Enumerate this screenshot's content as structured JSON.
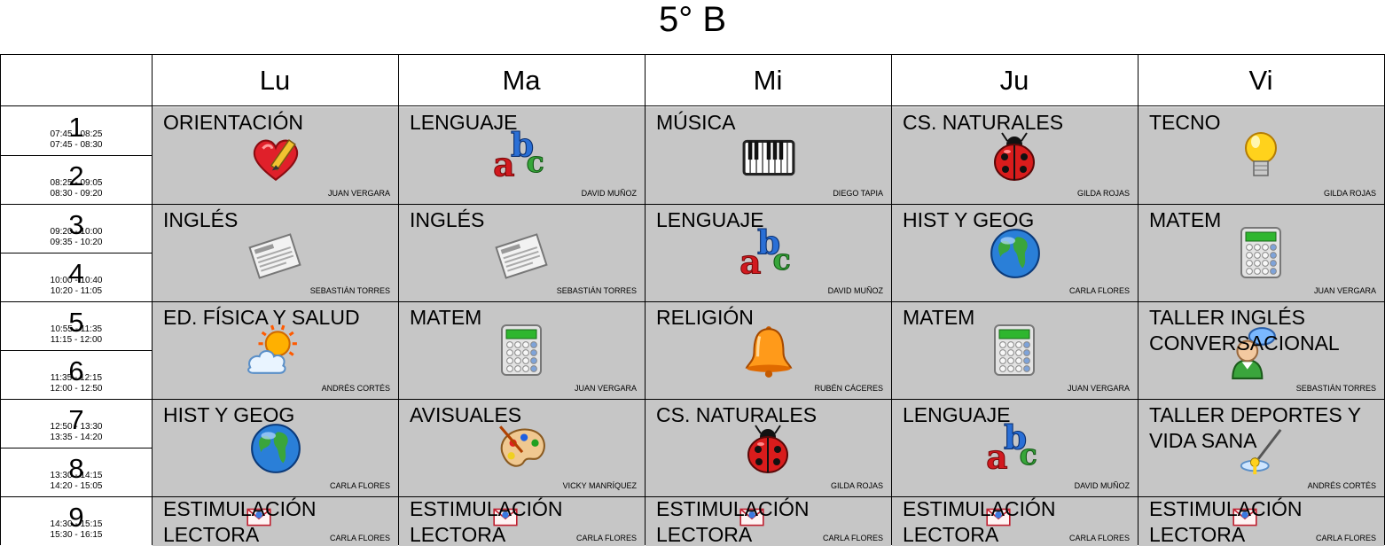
{
  "title": "5° B",
  "days": [
    "Lu",
    "Ma",
    "Mi",
    "Ju",
    "Vi"
  ],
  "slots": [
    {
      "num": "1",
      "time_a": "07:45 - 08:25",
      "time_b": "07:45 - 08:30"
    },
    {
      "num": "2",
      "time_a": "08:25 - 09:05",
      "time_b": "08:30 - 09:20"
    },
    {
      "num": "3",
      "time_a": "09:20 - 10:00",
      "time_b": "09:35 - 10:20"
    },
    {
      "num": "4",
      "time_a": "10:00 - 10:40",
      "time_b": "10:20 - 11:05"
    },
    {
      "num": "5",
      "time_a": "10:55 - 11:35",
      "time_b": "11:15 - 12:00"
    },
    {
      "num": "6",
      "time_a": "11:35 - 12:15",
      "time_b": "12:00 - 12:50"
    },
    {
      "num": "7",
      "time_a": "12:50 - 13:30",
      "time_b": "13:35 - 14:20"
    },
    {
      "num": "8",
      "time_a": "13:30 - 14:15",
      "time_b": "14:20 - 15:05"
    },
    {
      "num": "9",
      "time_a": "14:30 - 15:15",
      "time_b": "15:30 - 16:15"
    }
  ],
  "rows": [
    [
      {
        "subject": "ORIENTACIÓN",
        "teacher": "JUAN VERGARA",
        "icon": "heart-pencil-icon"
      },
      {
        "subject": "LENGUAJE",
        "teacher": "DAVID MUÑOZ",
        "icon": "abc-icon"
      },
      {
        "subject": "MÚSICA",
        "teacher": "DIEGO TAPIA",
        "icon": "piano-icon"
      },
      {
        "subject": "CS. NATURALES",
        "teacher": "GILDA ROJAS",
        "icon": "ladybug-icon"
      },
      {
        "subject": "TECNO",
        "teacher": "GILDA ROJAS",
        "icon": "lightbulb-icon"
      }
    ],
    [
      {
        "subject": "INGLÉS",
        "teacher": "SEBASTIÁN TORRES",
        "icon": "newspaper-icon"
      },
      {
        "subject": "INGLÉS",
        "teacher": "SEBASTIÁN TORRES",
        "icon": "newspaper-icon"
      },
      {
        "subject": "LENGUAJE",
        "teacher": "DAVID MUÑOZ",
        "icon": "abc-icon"
      },
      {
        "subject": "HIST Y GEOG",
        "teacher": "CARLA FLORES",
        "icon": "globe-icon"
      },
      {
        "subject": "MATEM",
        "teacher": "JUAN VERGARA",
        "icon": "calculator-icon"
      }
    ],
    [
      {
        "subject": "ED. FÍSICA Y SALUD",
        "teacher": "ANDRÉS CORTÉS",
        "icon": "sun-cloud-icon"
      },
      {
        "subject": "MATEM",
        "teacher": "JUAN VERGARA",
        "icon": "calculator-icon"
      },
      {
        "subject": "RELIGIÓN",
        "teacher": "RUBÉN CÁCERES",
        "icon": "bell-icon"
      },
      {
        "subject": "MATEM",
        "teacher": "JUAN VERGARA",
        "icon": "calculator-icon"
      },
      {
        "subject": "TALLER INGLÉS\nCONVERSACIONAL",
        "teacher": "SEBASTIÁN TORRES",
        "icon": "chat-person-icon"
      }
    ],
    [
      {
        "subject": "HIST Y GEOG",
        "teacher": "CARLA FLORES",
        "icon": "globe-icon"
      },
      {
        "subject": "AVISUALES",
        "teacher": "VICKY MANRÍQUEZ",
        "icon": "palette-icon"
      },
      {
        "subject": "CS. NATURALES",
        "teacher": "GILDA ROJAS",
        "icon": "ladybug-icon"
      },
      {
        "subject": "LENGUAJE",
        "teacher": "DAVID MUÑOZ",
        "icon": "abc-icon"
      },
      {
        "subject": "TALLER DEPORTES Y\nVIDA SANA",
        "teacher": "ANDRÉS CORTÉS",
        "icon": "golf-icon"
      }
    ],
    [
      {
        "subject": "ESTIMULACIÓN\nLECTORA",
        "teacher": "CARLA FLORES",
        "icon": "envelope-icon"
      },
      {
        "subject": "ESTIMULACIÓN\nLECTORA",
        "teacher": "CARLA FLORES",
        "icon": "envelope-icon"
      },
      {
        "subject": "ESTIMULACIÓN\nLECTORA",
        "teacher": "CARLA FLORES",
        "icon": "envelope-icon"
      },
      {
        "subject": "ESTIMULACIÓN\nLECTORA",
        "teacher": "CARLA FLORES",
        "icon": "envelope-icon"
      },
      {
        "subject": "ESTIMULACIÓN\nLECTORA",
        "teacher": "CARLA FLORES",
        "icon": "envelope-icon"
      }
    ]
  ]
}
